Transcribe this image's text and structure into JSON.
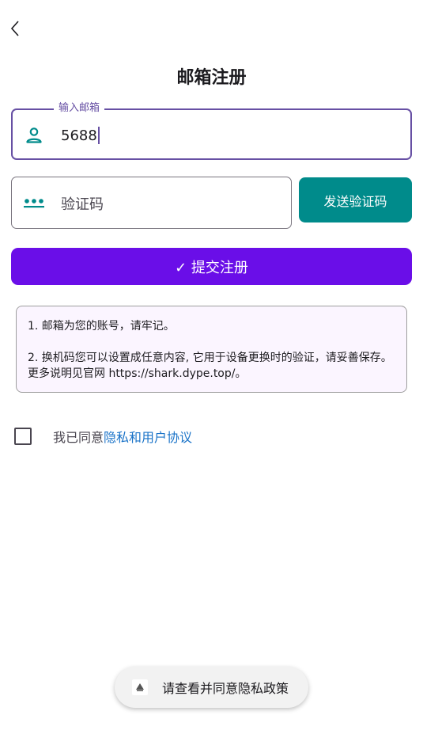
{
  "header": {
    "title": "邮箱注册"
  },
  "email_field": {
    "label": "输入邮箱",
    "value": "5688",
    "icon": "person-icon"
  },
  "code_field": {
    "placeholder": "验证码",
    "icon": "password-dots-icon"
  },
  "buttons": {
    "send_code": "发送验证码",
    "submit": "✓ 提交注册"
  },
  "notice": {
    "line1": "1. 邮箱为您的账号，请牢记。",
    "line2": "2. 换机码您可以设置成任意内容, 它用于设备更换时的验证，请妥善保存。更多说明见官网 https://shark.dype.top/。"
  },
  "agreement": {
    "checked": false,
    "prefix": "我已同意",
    "link": "隐私和用户协议"
  },
  "toast": {
    "text": "请查看并同意隐私政策"
  },
  "colors": {
    "primary": "#6750a4",
    "submit": "#6a0ee8",
    "teal": "#008b8b",
    "link": "#1a73c8"
  }
}
